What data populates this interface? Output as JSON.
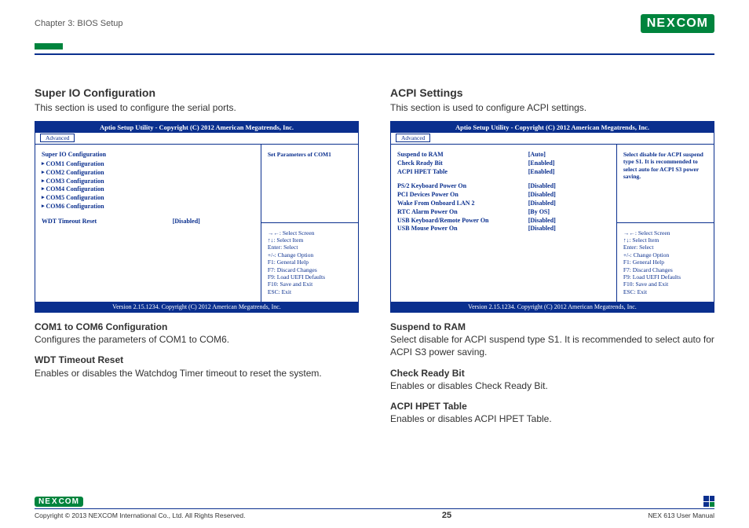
{
  "header": {
    "chapter": "Chapter 3: BIOS Setup",
    "brand_left": "NE",
    "brand_mid": "X",
    "brand_right": "COM"
  },
  "left": {
    "title": "Super IO Configuration",
    "intro": "This section is used to configure the serial ports.",
    "bios": {
      "title": "Aptio Setup Utility - Copyright (C) 2012 American Megatrends, Inc.",
      "tab": "Advanced",
      "heading": "Super IO Configuration",
      "items": [
        {
          "label": "COM1 Configuration",
          "value": ""
        },
        {
          "label": "COM2 Configuration",
          "value": ""
        },
        {
          "label": "COM3 Configuration",
          "value": ""
        },
        {
          "label": "COM4 Configuration",
          "value": ""
        },
        {
          "label": "COM5 Configuration",
          "value": ""
        },
        {
          "label": "COM6 Configuration",
          "value": ""
        }
      ],
      "extra": {
        "label": "WDT Timeout Reset",
        "value": "[Disabled]"
      },
      "info": "Set Parameters of COM1",
      "help": [
        "→←: Select Screen",
        "↑↓: Select Item",
        "Enter: Select",
        "+/-: Change Option",
        "F1: General Help",
        "F7: Discard Changes",
        "F9: Load UEFI Defaults",
        "F10: Save and Exit",
        "ESC: Exit"
      ],
      "footer": "Version 2.15.1234. Copyright (C) 2012 American Megatrends, Inc."
    },
    "desc": [
      {
        "title": "COM1 to COM6 Configuration",
        "body": "Configures the parameters of COM1 to COM6."
      },
      {
        "title": "WDT Timeout Reset",
        "body": "Enables or disables the Watchdog Timer timeout to reset the system."
      }
    ]
  },
  "right": {
    "title": "ACPI Settings",
    "intro": "This section is used to configure ACPI settings.",
    "bios": {
      "title": "Aptio Setup Utility - Copyright (C) 2012 American Megatrends, Inc.",
      "tab": "Advanced",
      "group1": [
        {
          "label": "Suspend to RAM",
          "value": "[Auto]"
        },
        {
          "label": "Check Ready Bit",
          "value": "[Enabled]"
        },
        {
          "label": "ACPI HPET Table",
          "value": "[Enabled]"
        }
      ],
      "group2": [
        {
          "label": "PS/2 Keyboard Power On",
          "value": "[Disabled]"
        },
        {
          "label": "PCI Devices Power On",
          "value": "[Disabled]"
        },
        {
          "label": "Wake From Onboard LAN 2",
          "value": "[Disabled]"
        },
        {
          "label": "RTC Alarm Power On",
          "value": "[By OS]"
        },
        {
          "label": "USB Keyboard/Remote Power On",
          "value": "[Disabled]"
        },
        {
          "label": "USB Mouse Power On",
          "value": "[Disabled]"
        }
      ],
      "info": "Select disable for ACPI suspend type S1. It is recommended to select auto for ACPI S3 power saving.",
      "help": [
        "→←: Select Screen",
        "↑↓: Select Item",
        "Enter: Select",
        "+/-: Change Option",
        "F1: General Help",
        "F7: Discard Changes",
        "F9: Load UEFI Defaults",
        "F10: Save and Exit",
        "ESC: Exit"
      ],
      "footer": "Version 2.15.1234. Copyright (C) 2012 American Megatrends, Inc."
    },
    "desc": [
      {
        "title": "Suspend to RAM",
        "body": "Select disable for ACPI suspend type S1. It is recommended to select auto for ACPI S3 power saving."
      },
      {
        "title": "Check Ready Bit",
        "body": "Enables or disables Check Ready Bit."
      },
      {
        "title": "ACPI HPET Table",
        "body": "Enables or disables ACPI HPET Table."
      }
    ]
  },
  "footer": {
    "copyright": "Copyright © 2013 NEXCOM International Co., Ltd. All Rights Reserved.",
    "page": "25",
    "manual": "NEX 613 User Manual"
  }
}
